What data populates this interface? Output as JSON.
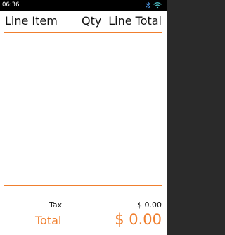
{
  "status_bar": {
    "time": "06:36",
    "icons": [
      "bluetooth-icon",
      "wifi-icon"
    ]
  },
  "table": {
    "headers": {
      "item": "Line Item",
      "qty": "Qty",
      "total": "Line Total"
    },
    "rows": []
  },
  "summary": {
    "tax_label": "Tax",
    "tax_value": "$ 0.00",
    "total_label": "Total",
    "total_value": "$ 0.00"
  },
  "colors": {
    "accent": "#f07f2e",
    "status_bar_bg": "#000000",
    "background": "#ffffff",
    "text": "#111111",
    "bluetooth": "#4a8fd8",
    "wifi": "#4fc3c9"
  }
}
